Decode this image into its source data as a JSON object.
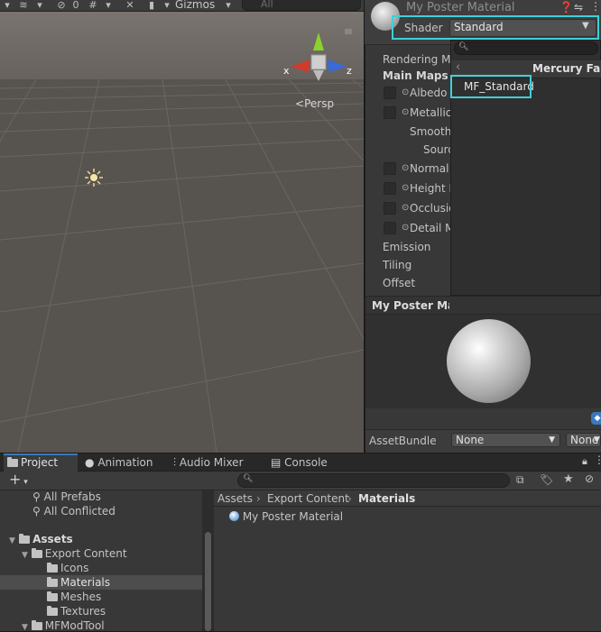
{
  "scene": {
    "toolbar": {
      "hidden_count": "0",
      "gizmos_label": "Gizmos",
      "search_placeholder": "All"
    },
    "persp_label": "Persp",
    "axes": {
      "x": "x",
      "z": "z"
    }
  },
  "inspector": {
    "material_name": "My Poster Material",
    "shader_label": "Shader",
    "shader_value": "Standard",
    "properties": {
      "rendering_mode": "Rendering Mode",
      "main_maps": "Main Maps",
      "albedo": "Albedo",
      "metallic": "Metallic",
      "smoothness": "Smoothness",
      "source": "Source",
      "normal_map": "Normal Map",
      "height_map": "Height Map",
      "occlusion": "Occlusion",
      "detail_mask": "Detail Mask",
      "emission": "Emission",
      "tiling": "Tiling",
      "offset": "Offset"
    },
    "preview_title": "My Poster Material",
    "asset_bundle_label": "AssetBundle",
    "asset_bundle_value": "None",
    "asset_variant_value": "None"
  },
  "shader_dropdown": {
    "group_label": "Mercury Fallen",
    "items": [
      "MF_Standard"
    ]
  },
  "bottom": {
    "tabs": [
      "Project",
      "Animation",
      "Audio Mixer",
      "Console"
    ],
    "add_label": "+",
    "tree": {
      "all_prefabs": "All Prefabs",
      "all_conflicted": "All Conflicted",
      "assets": "Assets",
      "export_content": "Export Content",
      "icons": "Icons",
      "materials": "Materials",
      "meshes": "Meshes",
      "textures": "Textures",
      "mfmodtool": "MFModTool"
    },
    "breadcrumb": [
      "Assets",
      "Export Content",
      "Materials"
    ],
    "files": [
      "My Poster Material"
    ]
  },
  "colors": {
    "highlight": "#3fd0d8",
    "gizmo_x": "#d33a2c",
    "gizmo_y": "#8cd22c",
    "gizmo_z": "#3a6ad8"
  }
}
